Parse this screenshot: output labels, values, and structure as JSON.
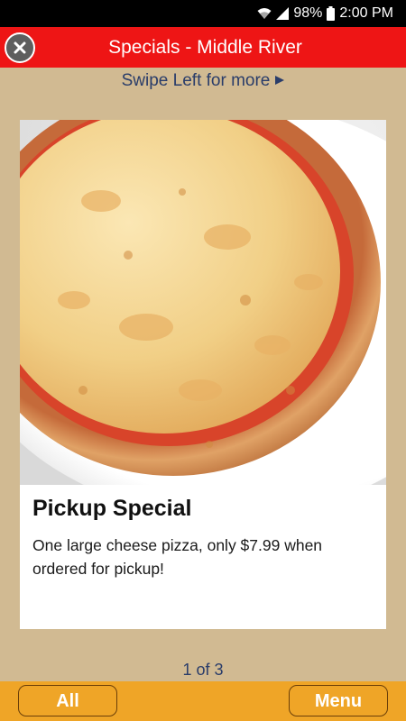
{
  "status_bar": {
    "battery": "98%",
    "time": "2:00 PM"
  },
  "header": {
    "title": "Specials - Middle River",
    "close_icon": "close-circle-icon"
  },
  "swipe_hint": {
    "text": "Swipe Left for more",
    "icon": "play-arrow-icon"
  },
  "special": {
    "image": "cheese pizza photo",
    "title": "Pickup Special",
    "description": "One large cheese pizza, only $7.99 when ordered for pickup!"
  },
  "pager": {
    "text": "1 of 3"
  },
  "bottom_bar": {
    "all_label": "All",
    "menu_label": "Menu"
  },
  "colors": {
    "header_bg": "#ee1515",
    "page_bg": "#d1ba92",
    "accent_text": "#2a3d6a",
    "bottom_bar_bg": "#efa527"
  }
}
